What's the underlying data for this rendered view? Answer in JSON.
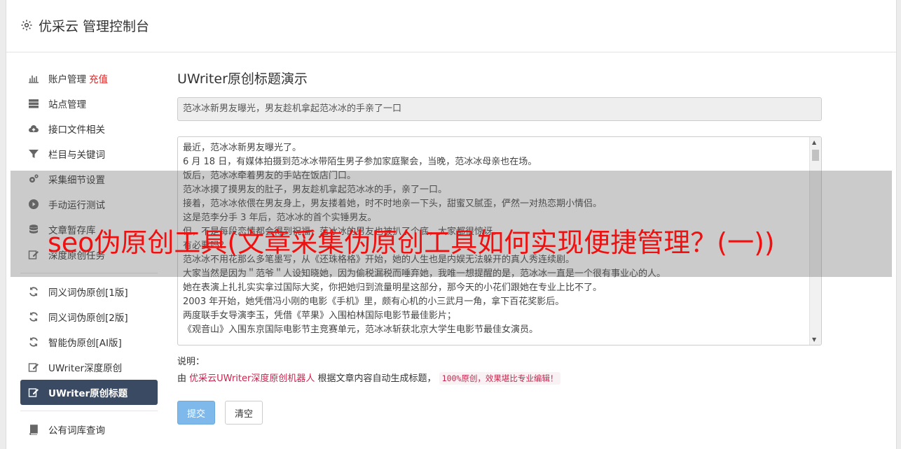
{
  "header": {
    "title": "优采云 管理控制台",
    "icon": "gear-icon"
  },
  "sidebar": {
    "items": [
      {
        "label": "账户管理",
        "badge": "充值",
        "icon": "bar-chart-icon"
      },
      {
        "label": "站点管理",
        "icon": "server-icon"
      },
      {
        "label": "接口文件相关",
        "icon": "cloud-upload-icon"
      },
      {
        "label": "栏目与关键词",
        "icon": "filter-icon"
      },
      {
        "label": "采集细节设置",
        "icon": "gears-icon"
      },
      {
        "label": "手动运行测试",
        "icon": "play-circle-icon"
      },
      {
        "label": "文章暂存库",
        "icon": "database-icon"
      },
      {
        "label": "深度原创任务",
        "icon": "edit-icon"
      },
      {
        "label": "同义词伪原创[1版]",
        "icon": "refresh-icon"
      },
      {
        "label": "同义词伪原创[2版]",
        "icon": "refresh-icon"
      },
      {
        "label": "智能伪原创[AI版]",
        "icon": "refresh-icon"
      },
      {
        "label": "UWriter深度原创",
        "icon": "edit-icon"
      },
      {
        "label": "UWriter原创标题",
        "icon": "edit-icon",
        "active": true
      },
      {
        "label": "公有词库查询",
        "icon": "book-icon"
      }
    ]
  },
  "main": {
    "heading": "UWriter原创标题演示",
    "title_value": "范冰冰新男友曝光，男友趁机拿起范冰冰的手亲了一口",
    "content_lines": [
      "最近，范冰冰新男友曝光了。",
      "6 月 18 日，有媒体拍摄到范冰冰带陌生男子参加家庭聚会，当晚，范冰冰母亲也在场。",
      "饭后，范冰冰牵着男友的手站在饭店门口。",
      "范冰冰摸了摸男友的肚子，男友趁机拿起范冰冰的手，亲了一口。",
      "接着，范冰冰依偎在男友身上，男友搂着她，时不时地亲一下头，甜蜜又腻歪，俨然一对热恋期小情侣。",
      "这是范李分手 3 年后，范冰冰的首个实锤男友。",
      "但，不是每段恋情都会得到祝福，范冰冰的男友也被扒了个底，大家都很惊讶。",
      "有必要吗？",
      "范冰冰不用花那么多笔墨写，从《还珠格格》开始，她的人生也是内娱无法躲开的真人秀连续剧。",
      "大家当然是因为＂范爷＂人设知晓她，因为偷税漏税而唾弃她，我唯一想提醒的是，范冰冰一直是一个很有事业心的人。",
      "她在表演上扎扎实实拿过国际大奖，你把她归到流量明星这部分，那今天的小花们跟她在专业上比不了。",
      "2003 年开始，她凭借冯小刚的电影《手机》里，颇有心机的小三武月一角，拿下百花奖影后。",
      "两度联手女导演李玉，凭借《苹果》入围柏林国际电影节最佳影片；",
      "《观音山》入围东京国际电影节主竞赛单元，范冰冰斩获北京大学生电影节最佳女演员。"
    ],
    "help_label": "说明：",
    "help_prefix": "由",
    "help_link": "优采云UWriter深度原创机器人",
    "help_middle": "根据文章内容自动生成标题，",
    "help_code": "100%原创，效果堪比专业编辑！",
    "submit_label": "提交",
    "clear_label": "清空"
  },
  "overlay": {
    "text": "seo伪原创工具(文章采集伪原创工具如何实现便捷管理？(一))"
  },
  "colors": {
    "accent": "#3b4a63",
    "primary": "#7fb8ea",
    "danger": "#e02020",
    "code": "#c7254e"
  }
}
